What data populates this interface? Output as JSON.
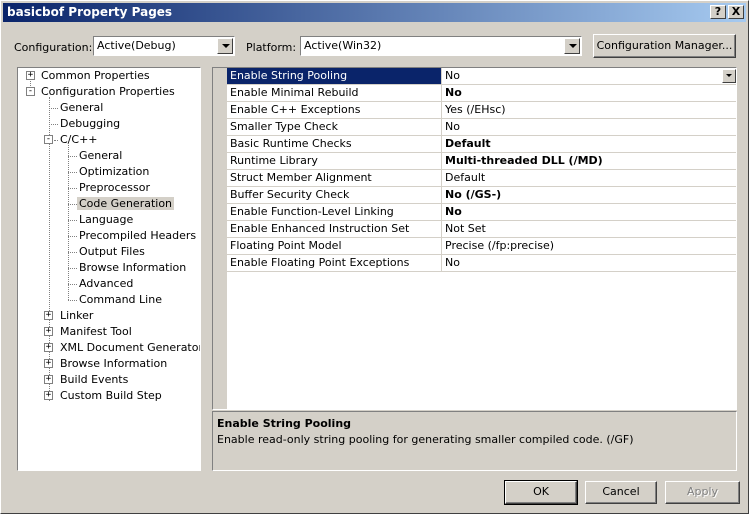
{
  "window": {
    "title": "basicbof Property Pages",
    "help_label": "?",
    "close_label": "X"
  },
  "config_bar": {
    "configuration_label": "Configuration:",
    "configuration_value": "Active(Debug)",
    "platform_label": "Platform:",
    "platform_value": "Active(Win32)",
    "manager_button": "Configuration Manager..."
  },
  "tree": {
    "common": "Common Properties",
    "config": "Configuration Properties",
    "general": "General",
    "debugging": "Debugging",
    "cpp": "C/C++",
    "cpp_children": [
      "General",
      "Optimization",
      "Preprocessor",
      "Code Generation",
      "Language",
      "Precompiled Headers",
      "Output Files",
      "Browse Information",
      "Advanced",
      "Command Line"
    ],
    "after_cpp": [
      "Linker",
      "Manifest Tool",
      "XML Document Generator",
      "Browse Information",
      "Build Events",
      "Custom Build Step"
    ],
    "expand_plus": "+",
    "expand_minus": "-"
  },
  "properties": [
    {
      "name": "Enable String Pooling",
      "value": "No",
      "bold": false
    },
    {
      "name": "Enable Minimal Rebuild",
      "value": "No",
      "bold": true
    },
    {
      "name": "Enable C++ Exceptions",
      "value": "Yes (/EHsc)",
      "bold": false
    },
    {
      "name": "Smaller Type Check",
      "value": "No",
      "bold": false
    },
    {
      "name": "Basic Runtime Checks",
      "value": "Default",
      "bold": true
    },
    {
      "name": "Runtime Library",
      "value": "Multi-threaded DLL (/MD)",
      "bold": true
    },
    {
      "name": "Struct Member Alignment",
      "value": "Default",
      "bold": false
    },
    {
      "name": "Buffer Security Check",
      "value": "No (/GS-)",
      "bold": true
    },
    {
      "name": "Enable Function-Level Linking",
      "value": "No",
      "bold": true
    },
    {
      "name": "Enable Enhanced Instruction Set",
      "value": "Not Set",
      "bold": false
    },
    {
      "name": "Floating Point Model",
      "value": "Precise (/fp:precise)",
      "bold": false
    },
    {
      "name": "Enable Floating Point Exceptions",
      "value": "No",
      "bold": false
    }
  ],
  "description": {
    "title": "Enable String Pooling",
    "text": "Enable read-only string pooling for generating smaller compiled code.     (/GF)"
  },
  "buttons": {
    "ok": "OK",
    "cancel": "Cancel",
    "apply": "Apply"
  },
  "colors": {
    "selection": "#0a246a",
    "face": "#d4d0c8"
  }
}
